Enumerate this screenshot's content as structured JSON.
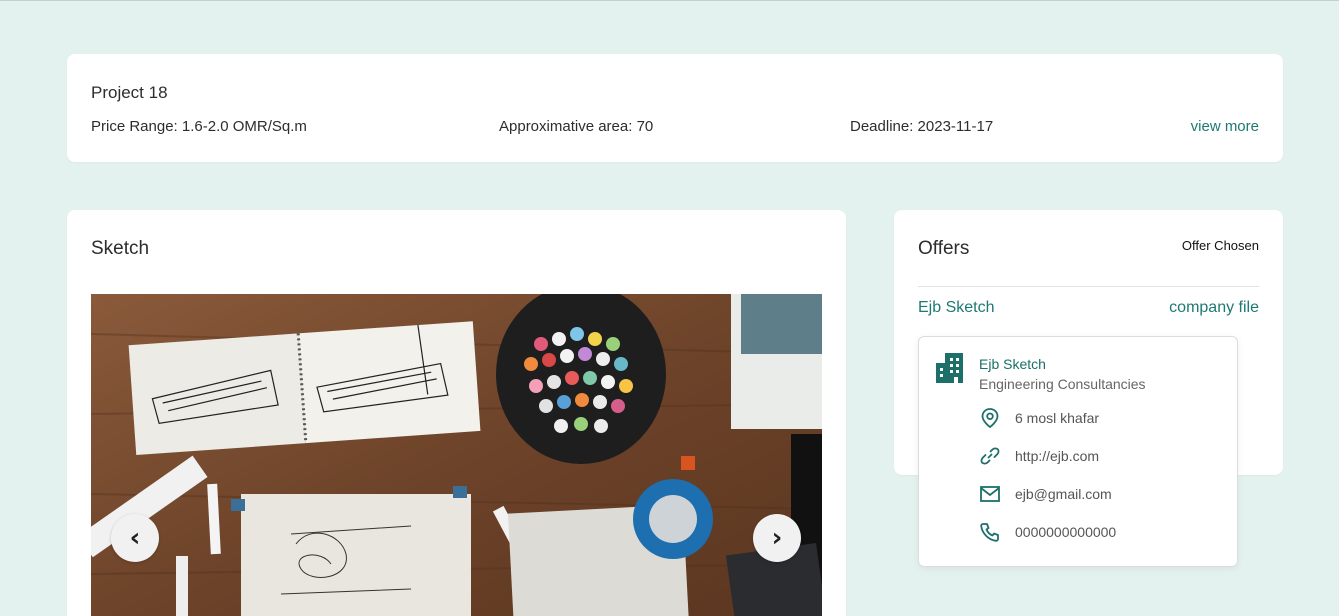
{
  "project": {
    "title": "Project 18",
    "price_range": "Price Range: 1.6-2.0 OMR/Sq.m",
    "area": "Approximative area: 70",
    "deadline": "Deadline: 2023-11-17",
    "view_more": "view more"
  },
  "sketch": {
    "title": "Sketch",
    "prev_label": "‹",
    "next_label": "›"
  },
  "offers": {
    "title": "Offers",
    "status": "Offer Chosen",
    "offer_name": "Ejb Sketch",
    "company_file": "company file"
  },
  "company": {
    "name": "Ejb Sketch",
    "type": "Engineering Consultancies",
    "address": "6 mosl khafar",
    "website": "http://ejb.com",
    "email": "ejb@gmail.com",
    "phone": "0000000000000"
  },
  "colors": {
    "background": "#e4f2ef",
    "accent": "#1d7a72",
    "icon": "#1d6f69"
  }
}
